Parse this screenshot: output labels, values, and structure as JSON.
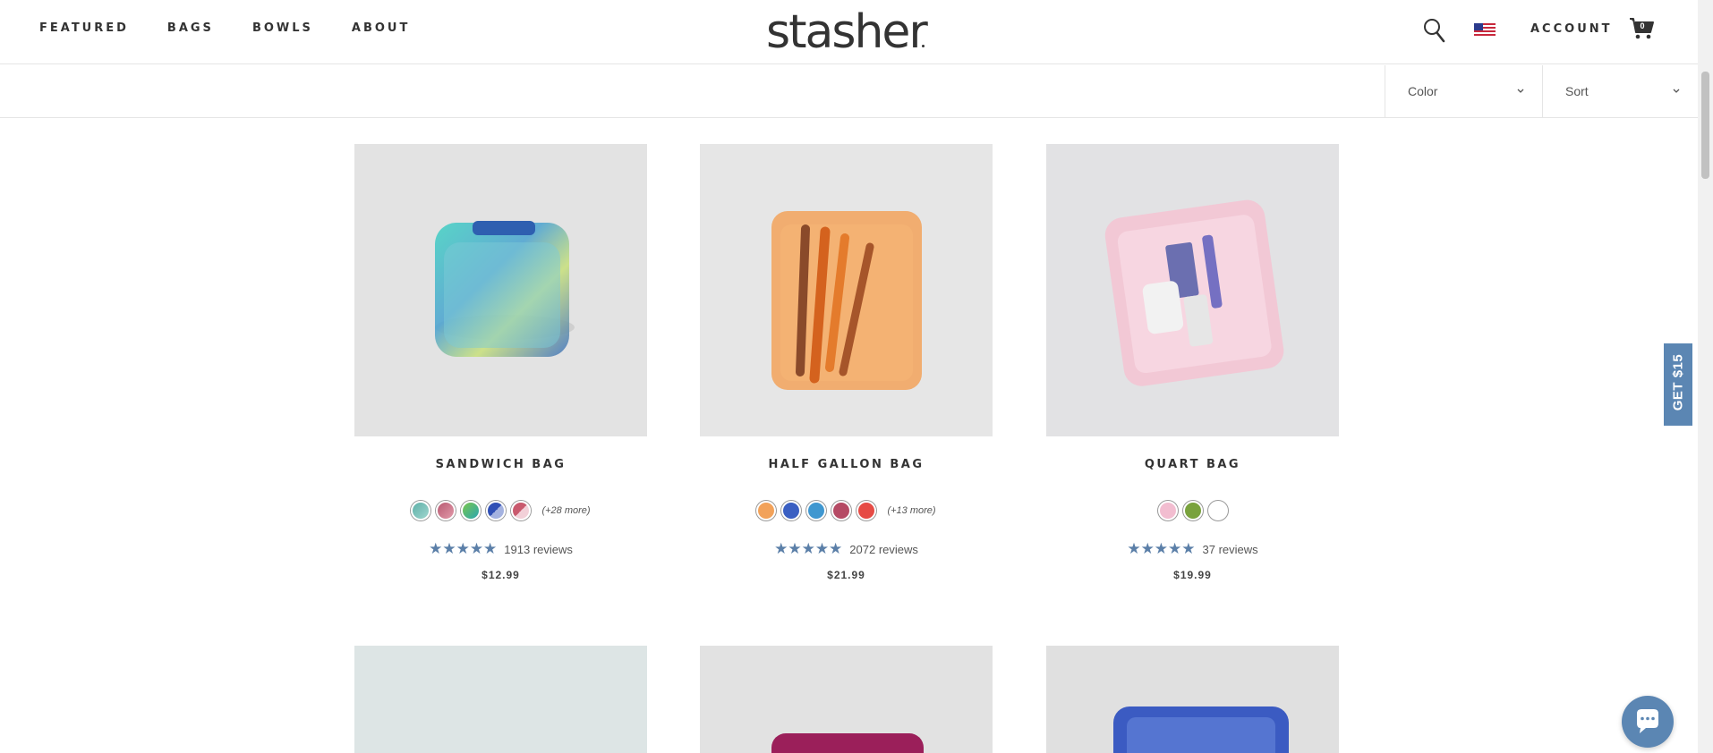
{
  "header": {
    "nav": [
      "FEATURED",
      "BAGS",
      "BOWLS",
      "ABOUT"
    ],
    "logo": "stasher",
    "account": "ACCOUNT",
    "cart_count": "0"
  },
  "filters": {
    "color": "Color",
    "sort": "Sort"
  },
  "products": [
    {
      "name": "SANDWICH BAG",
      "swatches": [
        "#6fb8b8",
        "#c76b7f",
        "#3fb59b",
        "#3f5dbf",
        "#d77b8c"
      ],
      "more": "(+28 more)",
      "stars": "★★★★★",
      "reviews": "1913 reviews",
      "price": "$12.99"
    },
    {
      "name": "HALF GALLON BAG",
      "swatches": [
        "#f2a25a",
        "#3a5fc2",
        "#3f97d0",
        "#b54a64",
        "#e64b45"
      ],
      "more": "(+13 more)",
      "stars": "★★★★★",
      "reviews": "2072 reviews",
      "price": "$21.99"
    },
    {
      "name": "QUART BAG",
      "swatches": [
        "#f2bdd0",
        "#79a23d",
        "#ffffff"
      ],
      "more": "",
      "stars": "★★★★★",
      "reviews": "37 reviews",
      "price": "$19.99"
    }
  ],
  "promo_tab": "GET $15",
  "icons": [
    "search-icon",
    "us-flag-icon",
    "cart-icon",
    "chevron-down-icon",
    "chat-icon"
  ],
  "colors": {
    "accent": "#5b86b3",
    "star": "#5b7fa8"
  }
}
